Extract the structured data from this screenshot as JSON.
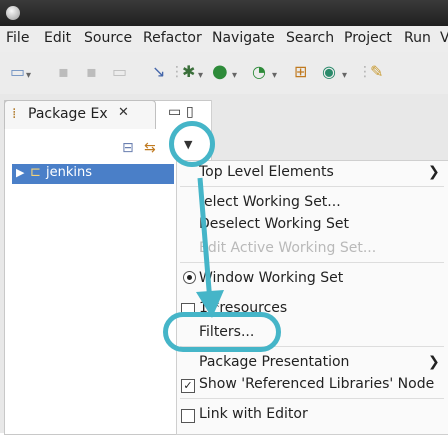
{
  "menubar": {
    "items": [
      {
        "label": "File",
        "hotkey_index": 0
      },
      {
        "label": "Edit",
        "hotkey_index": 0
      },
      {
        "label": "Source",
        "hotkey_index": 0
      },
      {
        "label": "Refactor",
        "hotkey_index": 5
      },
      {
        "label": "Navigate",
        "hotkey_index": 0
      },
      {
        "label": "Search",
        "hotkey_index": 0
      },
      {
        "label": "Project",
        "hotkey_index": 0
      },
      {
        "label": "Run",
        "hotkey_index": 0
      },
      {
        "label": "V",
        "hotkey_index": 0
      }
    ]
  },
  "view": {
    "tab_title": "Package Ex",
    "tree": [
      {
        "label": "jenkins"
      }
    ]
  },
  "view_menu": {
    "items": {
      "top_level": "Top Level Elements",
      "select_ws": "elect Working Set...",
      "deselect_ws": "Deselect Working Set",
      "edit_active_ws": "Edit Active Working Set...",
      "window_ws": "Window Working Set",
      "recent_ws": "1 *resources",
      "filters": "Filters...",
      "pkg_presentation": "Package Presentation",
      "show_ref_libs": "Show 'Referenced Libraries' Node",
      "link_editor": "Link with Editor"
    }
  },
  "highlight_color": "#45b5c8",
  "selection_color": "#4a7fc8"
}
